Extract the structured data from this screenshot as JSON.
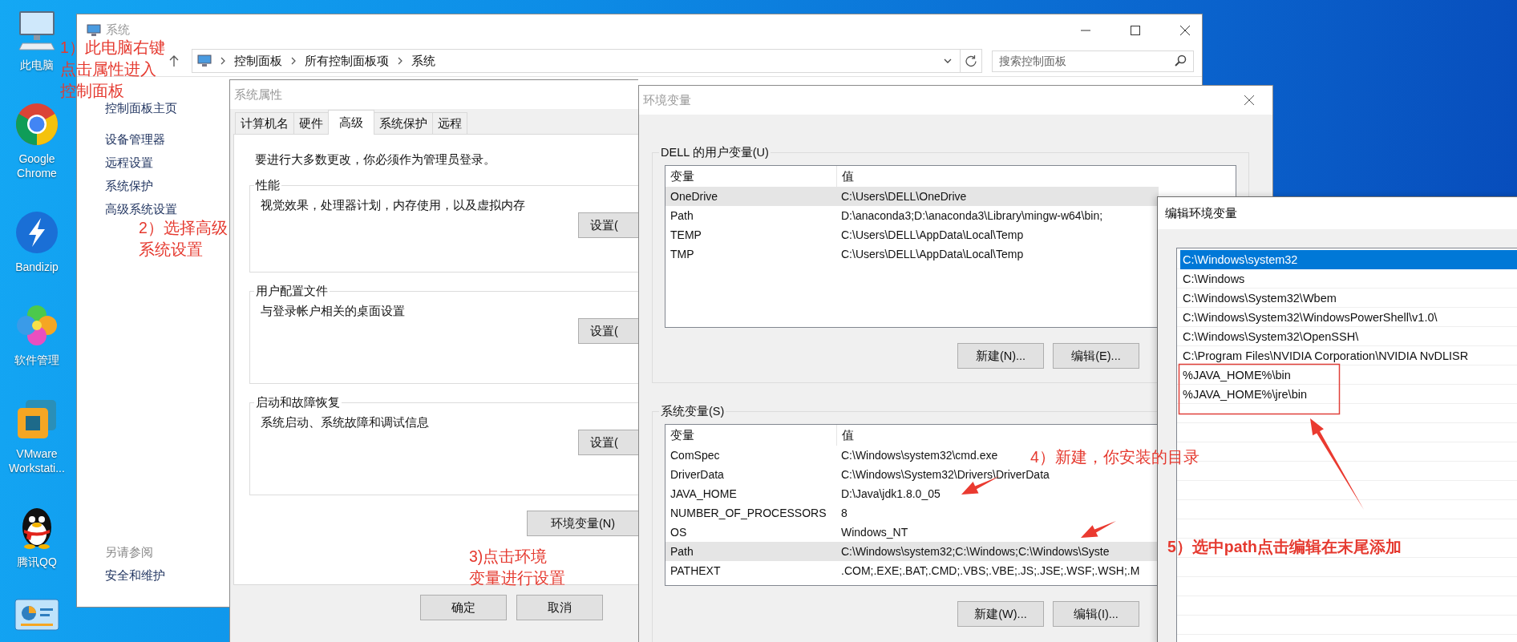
{
  "desktop_icons": [
    {
      "kind": "computer",
      "label": "此电脑"
    },
    {
      "kind": "chrome",
      "label": "Google Chrome"
    },
    {
      "kind": "bandizip",
      "label": "Bandizip"
    },
    {
      "kind": "software",
      "label": "软件管理"
    },
    {
      "kind": "vmware",
      "label": "VMware Workstati..."
    },
    {
      "kind": "qq",
      "label": "腾讯QQ"
    },
    {
      "kind": "dashboard"
    }
  ],
  "system_window": {
    "title": "系统",
    "breadcrumb": [
      "控制面板",
      "所有控制面板项",
      "系统"
    ],
    "search": {
      "placeholder": "搜索控制面板"
    },
    "sidebar": {
      "home": "控制面板主页",
      "links": [
        "设备管理器",
        "远程设置",
        "系统保护",
        "高级系统设置"
      ],
      "see_also": {
        "heading": "另请参阅",
        "links": [
          "安全和维护"
        ]
      }
    }
  },
  "properties_dialog": {
    "title": "系统属性",
    "tabs": [
      {
        "label": "计算机名",
        "selected": false
      },
      {
        "label": "硬件",
        "selected": false
      },
      {
        "label": "高级",
        "selected": true
      },
      {
        "label": "系统保护",
        "selected": false
      },
      {
        "label": "远程",
        "selected": false
      }
    ],
    "notice": "要进行大多数更改，你必须作为管理员登录。",
    "groups": [
      {
        "title": "性能",
        "description": "视觉效果，处理器计划，内存使用，以及虚拟内存",
        "button": "设置("
      },
      {
        "title": "用户配置文件",
        "description": "与登录帐户相关的桌面设置",
        "button": "设置("
      },
      {
        "title": "启动和故障恢复",
        "description": "系统启动、系统故障和调试信息",
        "button": "设置("
      }
    ],
    "env_button": "环境变量(N)",
    "buttons": [
      "确定",
      "取消"
    ]
  },
  "env_dialog": {
    "title": "环境变量",
    "sections": [
      {
        "title": "DELL 的用户变量(U)",
        "columns": [
          "变量",
          "值"
        ],
        "rows": [
          {
            "name": "OneDrive",
            "value": "C:\\Users\\DELL\\OneDrive",
            "selected": true
          },
          {
            "name": "Path",
            "value": "D:\\anaconda3;D:\\anaconda3\\Library\\mingw-w64\\bin;",
            "selected": false
          },
          {
            "name": "TEMP",
            "value": "C:\\Users\\DELL\\AppData\\Local\\Temp",
            "selected": false
          },
          {
            "name": "TMP",
            "value": "C:\\Users\\DELL\\AppData\\Local\\Temp",
            "selected": false
          }
        ],
        "buttons": [
          "新建(N)...",
          "编辑(E)..."
        ]
      },
      {
        "title": "系统变量(S)",
        "columns": [
          "变量",
          "值"
        ],
        "rows": [
          {
            "name": "ComSpec",
            "value": "C:\\Windows\\system32\\cmd.exe",
            "selected": false
          },
          {
            "name": "DriverData",
            "value": "C:\\Windows\\System32\\Drivers\\DriverData",
            "selected": false
          },
          {
            "name": "JAVA_HOME",
            "value": "D:\\Java\\jdk1.8.0_05",
            "selected": false
          },
          {
            "name": "NUMBER_OF_PROCESSORS",
            "value": "8",
            "selected": false
          },
          {
            "name": "OS",
            "value": "Windows_NT",
            "selected": false
          },
          {
            "name": "Path",
            "value": "C:\\Windows\\system32;C:\\Windows;C:\\Windows\\Syste",
            "selected": true
          },
          {
            "name": "PATHEXT",
            "value": ".COM;.EXE;.BAT;.CMD;.VBS;.VBE;.JS;.JSE;.WSF;.WSH;.M",
            "selected": false
          }
        ],
        "buttons": [
          "新建(W)...",
          "编辑(I)..."
        ]
      }
    ]
  },
  "edit_dialog": {
    "title": "编辑环境变量",
    "entries": [
      {
        "text": "C:\\Windows\\system32",
        "selected": true
      },
      {
        "text": "C:\\Windows",
        "selected": false
      },
      {
        "text": "C:\\Windows\\System32\\Wbem",
        "selected": false
      },
      {
        "text": "C:\\Windows\\System32\\WindowsPowerShell\\v1.0\\",
        "selected": false
      },
      {
        "text": "C:\\Windows\\System32\\OpenSSH\\",
        "selected": false
      },
      {
        "text": "C:\\Program Files\\NVIDIA Corporation\\NVIDIA NvDLISR",
        "selected": false
      },
      {
        "text": "%JAVA_HOME%\\bin",
        "selected": false
      },
      {
        "text": "%JAVA_HOME%\\jre\\bin",
        "selected": false
      }
    ]
  },
  "annotations": [
    {
      "lines": [
        "1）此电脑右键",
        "点击属性进入",
        "控制面板"
      ]
    },
    {
      "lines": [
        "2）选择高级",
        "系统设置"
      ]
    },
    {
      "lines": [
        "3)点击环境",
        "变量进行设置"
      ]
    },
    {
      "lines": [
        "4）新建，你安装的目录"
      ]
    },
    {
      "lines": [
        "5）选中path点击编辑在末尾添加"
      ]
    }
  ]
}
